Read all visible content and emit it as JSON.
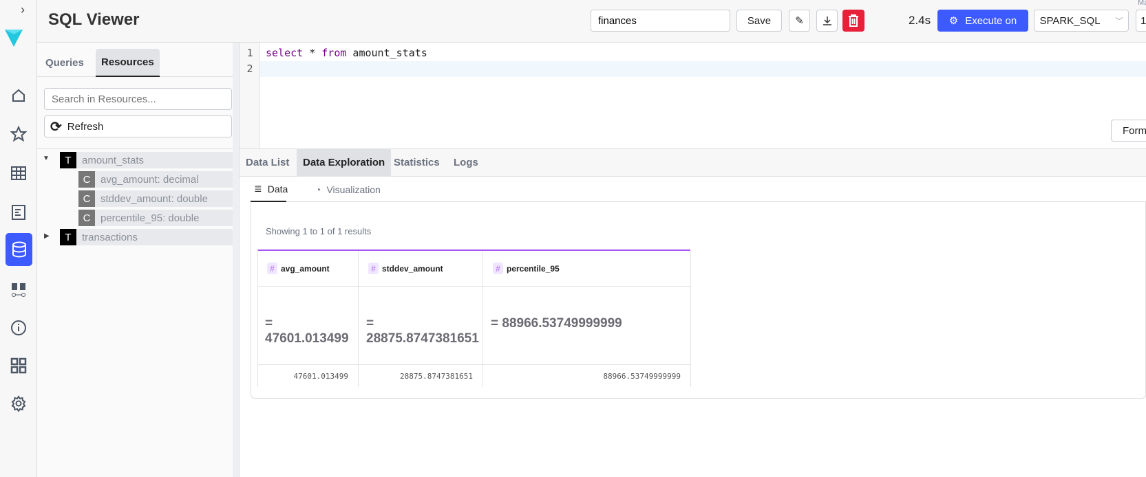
{
  "header": {
    "title": "SQL Viewer",
    "query_name": "finances",
    "save_label": "Save",
    "elapsed": "2.4s",
    "execute_label": "Execute on",
    "engine": "SPARK_SQL",
    "limit_label": "Ma",
    "limit_value": "1"
  },
  "sidebar": {
    "tabs": [
      "Queries",
      "Resources"
    ],
    "search_placeholder": "Search in Resources...",
    "refresh_label": "Refresh",
    "tree": [
      {
        "badge": "T",
        "label": "amount_stats",
        "expanded": true,
        "children": [
          {
            "badge": "C",
            "label": "avg_amount: decimal"
          },
          {
            "badge": "C",
            "label": "stddev_amount: double"
          },
          {
            "badge": "C",
            "label": "percentile_95: double"
          }
        ]
      },
      {
        "badge": "T",
        "label": "transactions",
        "expanded": false
      }
    ]
  },
  "editor": {
    "lines": [
      "1",
      "2"
    ],
    "kw1": "select",
    "op": " * ",
    "kw2": "from",
    "rest": " amount_stats",
    "format_label": "Form"
  },
  "results": {
    "tabs": [
      "Data List",
      "Data Exploration",
      "Statistics",
      "Logs"
    ],
    "subtabs": [
      "Data",
      "Visualization"
    ],
    "summary": "Showing 1 to 1 of 1 results",
    "columns": [
      {
        "name": "avg_amount",
        "summary": "= 47601.013499",
        "value": "47601.013499"
      },
      {
        "name": "stddev_amount",
        "summary": "= 28875.8747381651",
        "value": "28875.8747381651"
      },
      {
        "name": "percentile_95",
        "summary": "= 88966.53749999999",
        "value": "88966.53749999999"
      }
    ]
  },
  "colors": {
    "accent": "#3d5afe",
    "danger": "#e8213a",
    "purple": "#a855f7"
  }
}
